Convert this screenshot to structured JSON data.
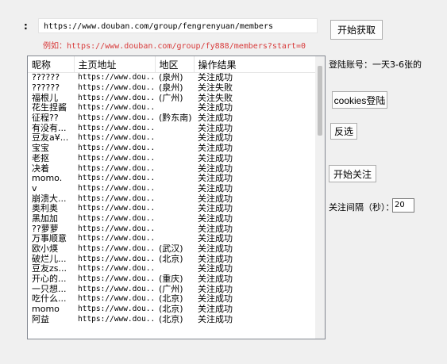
{
  "form": {
    "url_label": ":",
    "url_value": "https://www.douban.com/group/fengrenyuan/members",
    "example_text": "例如：https://www.douban.com/group/fy888/members?start=0",
    "fetch_button": "开始获取"
  },
  "table": {
    "headers": [
      "昵称",
      "主页地址",
      "地区",
      "操作结果"
    ],
    "rows": [
      [
        "??????",
        "https://www.dou...",
        "(泉州)",
        "关注成功"
      ],
      [
        "??????",
        "https://www.dou...",
        "(泉州)",
        "关注失败"
      ],
      [
        "福根儿",
        "https://www.dou...",
        "(广州)",
        "关注失败"
      ],
      [
        "花生捏酱",
        "https://www.dou...",
        "",
        "关注成功"
      ],
      [
        "征程??",
        "https://www.dou...",
        "(黔东南)",
        "关注成功"
      ],
      [
        "有没有...",
        "https://www.dou...",
        "",
        "关注成功"
      ],
      [
        "豆友a¥...",
        "https://www.dou...",
        "",
        "关注成功"
      ],
      [
        "宝宝",
        "https://www.dou...",
        "",
        "关注成功"
      ],
      [
        "老抠",
        "https://www.dou...",
        "",
        "关注成功"
      ],
      [
        "决着",
        "https://www.dou...",
        "",
        "关注成功"
      ],
      [
        "momo.",
        "https://www.dou...",
        "",
        "关注成功"
      ],
      [
        "v",
        "https://www.dou...",
        "",
        "关注成功"
      ],
      [
        "崩溃大...",
        "https://www.dou...",
        "",
        "关注成功"
      ],
      [
        "奥利奥",
        "https://www.dou...",
        "",
        "关注成功"
      ],
      [
        "黑加加",
        "https://www.dou...",
        "",
        "关注成功"
      ],
      [
        "??萝萝",
        "https://www.dou...",
        "",
        "关注成功"
      ],
      [
        "万事顺意",
        "https://www.dou...",
        "",
        "关注成功"
      ],
      [
        "欧小煐",
        "https://www.dou...",
        "(武汉)",
        "关注成功"
      ],
      [
        "破烂儿...",
        "https://www.dou...",
        "(北京)",
        "关注成功"
      ],
      [
        "豆友zs...",
        "https://www.dou...",
        "",
        "关注成功"
      ],
      [
        "开心的...",
        "https://www.dou...",
        "(重庆)",
        "关注成功"
      ],
      [
        "一只想...",
        "https://www.dou...",
        "(广州)",
        "关注成功"
      ],
      [
        "吃什么...",
        "https://www.dou...",
        "(北京)",
        "关注成功"
      ],
      [
        "momo",
        "https://www.dou...",
        "(北京)",
        "关注成功"
      ],
      [
        "阿益",
        "https://www.dou...",
        "(北京)",
        "关注成功"
      ]
    ]
  },
  "side": {
    "login_label": "登陆账号：一天3-6张的",
    "cookies_button": "cookies登陆",
    "invert_button": "反选",
    "start_follow_button": "开始关注",
    "interval_label": "关注间隔（秒）：",
    "interval_value": "20"
  }
}
